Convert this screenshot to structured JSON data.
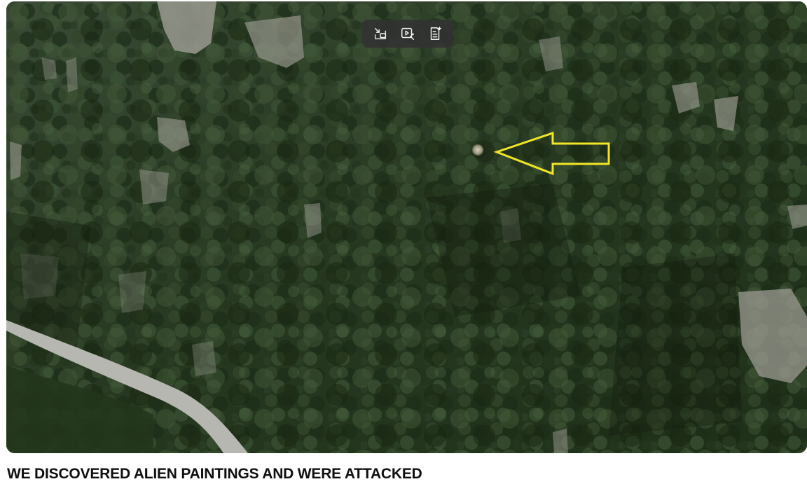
{
  "video": {
    "title": "WE DISCOVERED ALIEN PAINTINGS AND WERE ATTACKED",
    "annotation_arrow_color": "#f2e626",
    "orb_color": "#d8cdb8"
  },
  "toolbar": {
    "buttons": [
      {
        "icon": "picture-in-picture-icon"
      },
      {
        "icon": "video-magic-icon"
      },
      {
        "icon": "document-sparkle-icon"
      }
    ]
  }
}
